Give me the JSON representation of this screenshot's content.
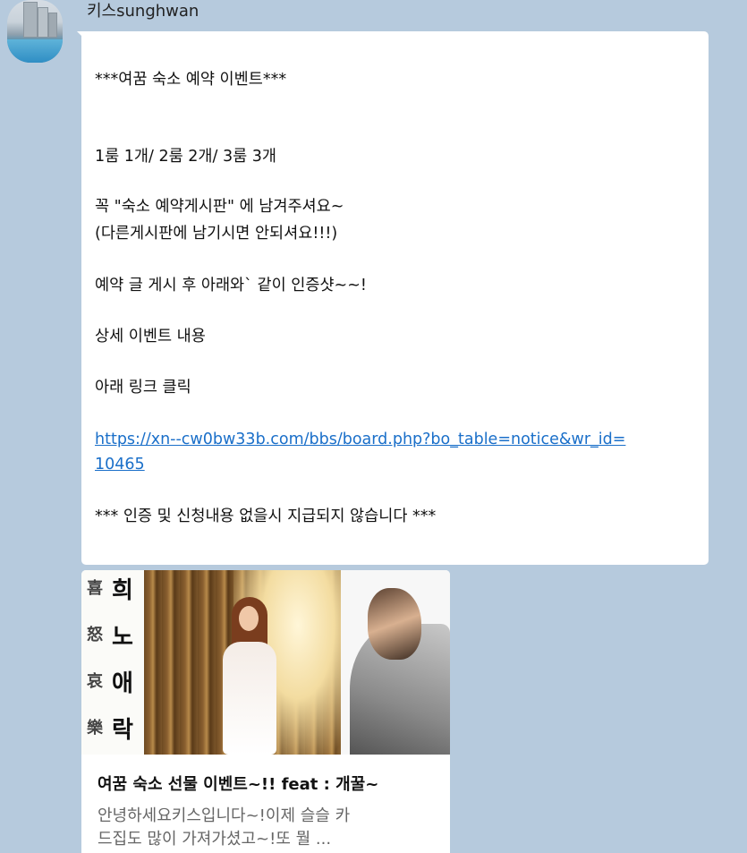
{
  "sender": {
    "name": "키스sunghwan"
  },
  "message": {
    "lines": [
      "***여꿈 숙소 예약 이벤트***",
      "1룸 1개/ 2룸 2개/ 3룸 3개",
      "꼭  \"숙소 예약게시판\" 에 남겨주셔요~",
      "(다른게시판에 남기시면 안되셔요!!!)",
      "예약 글 게시 후 아래와` 같이 인증샷~~!",
      "상세 이벤트 내용",
      "아래 링크 클릭",
      "https://xn--cw0bw33b.com/bbs/board.php?bo_table=notice&wr_id=",
      "10465",
      "*** 인증 및 신청내용 없을시 지급되지 않습니다 ***"
    ]
  },
  "link_preview": {
    "title": "여꿈 숙소 선물 이벤트~!! feat : 개꿀~",
    "description_line1": "안녕하세요키스입니다~!이제 슬슬 카",
    "description_line2": "드집도 많이 가져가셨고~!또 뭘 ...",
    "image_calligraphy": [
      "희",
      "노",
      "애",
      "락"
    ],
    "image_side_glyphs": [
      "喜",
      "怒",
      "哀",
      "樂"
    ]
  },
  "colors": {
    "background": "#b6cadd",
    "bubble": "#ffffff",
    "link": "#1a6fc9"
  }
}
